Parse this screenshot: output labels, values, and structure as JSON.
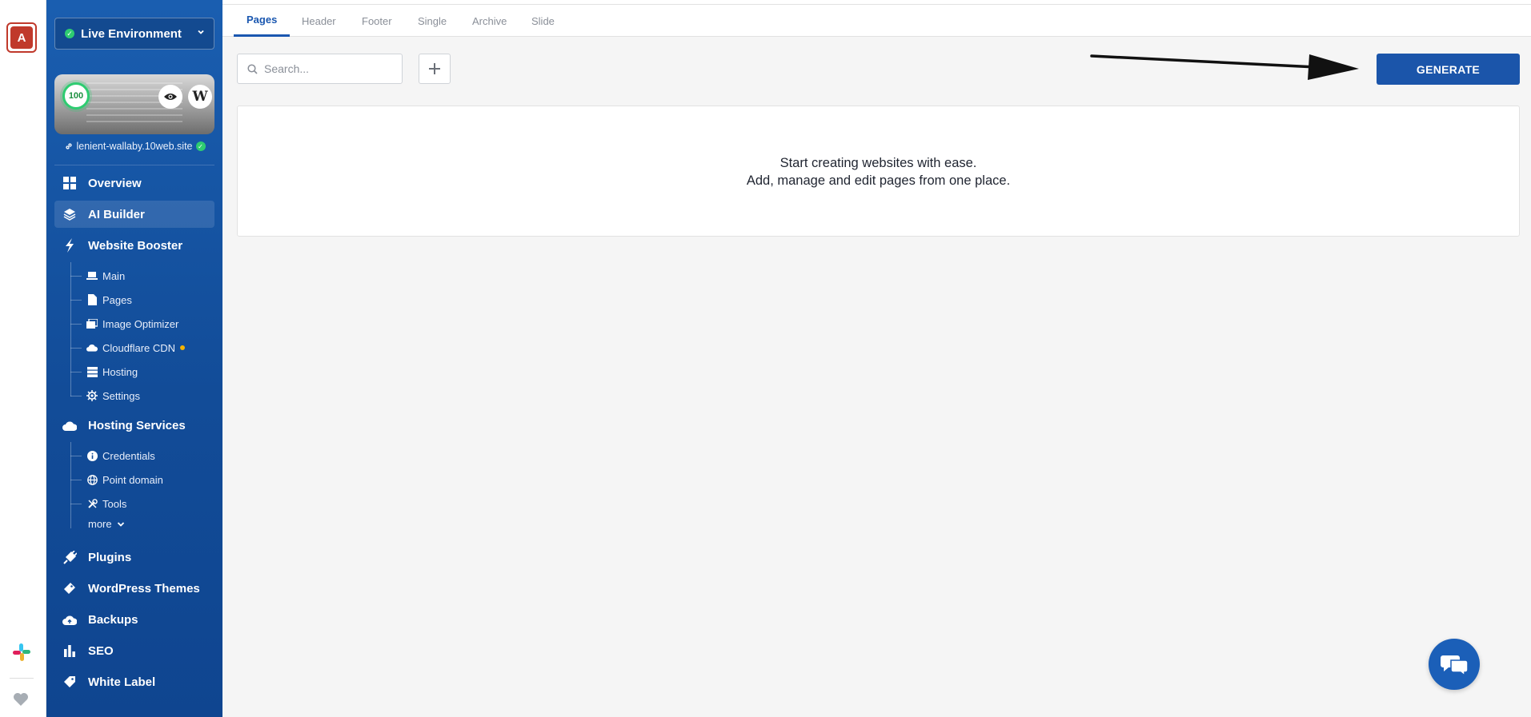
{
  "rail": {
    "avatar_letter": "A",
    "brand_color": "#c0392b"
  },
  "sidebar": {
    "environment": "Live Environment",
    "score": "100",
    "domain": "lenient-wallaby.10web.site",
    "nav": {
      "overview": "Overview",
      "ai_builder": "AI Builder",
      "website_booster": "Website Booster",
      "hosting_services": "Hosting Services",
      "plugins": "Plugins",
      "wordpress_themes": "WordPress Themes",
      "backups": "Backups",
      "seo": "SEO",
      "white_label": "White Label"
    },
    "booster_items": {
      "main": "Main",
      "pages": "Pages",
      "image_optimizer": "Image Optimizer",
      "cloudflare_cdn": "Cloudflare CDN",
      "hosting": "Hosting",
      "settings": "Settings"
    },
    "hosting_items": {
      "credentials": "Credentials",
      "point_domain": "Point domain",
      "tools": "Tools"
    },
    "more": "more",
    "accent": "#1a5eb0"
  },
  "tabs": {
    "pages": "Pages",
    "header": "Header",
    "footer": "Footer",
    "single": "Single",
    "archive": "Archive",
    "slide": "Slide"
  },
  "toolbar": {
    "search_placeholder": "Search...",
    "generate_label": "GENERATE"
  },
  "empty_state": {
    "line1": "Start creating websites with ease.",
    "line2": "Add, manage and edit pages from one place."
  },
  "colors": {
    "primary": "#1b55aa",
    "success": "#2ecc71",
    "warning": "#f5b400"
  }
}
